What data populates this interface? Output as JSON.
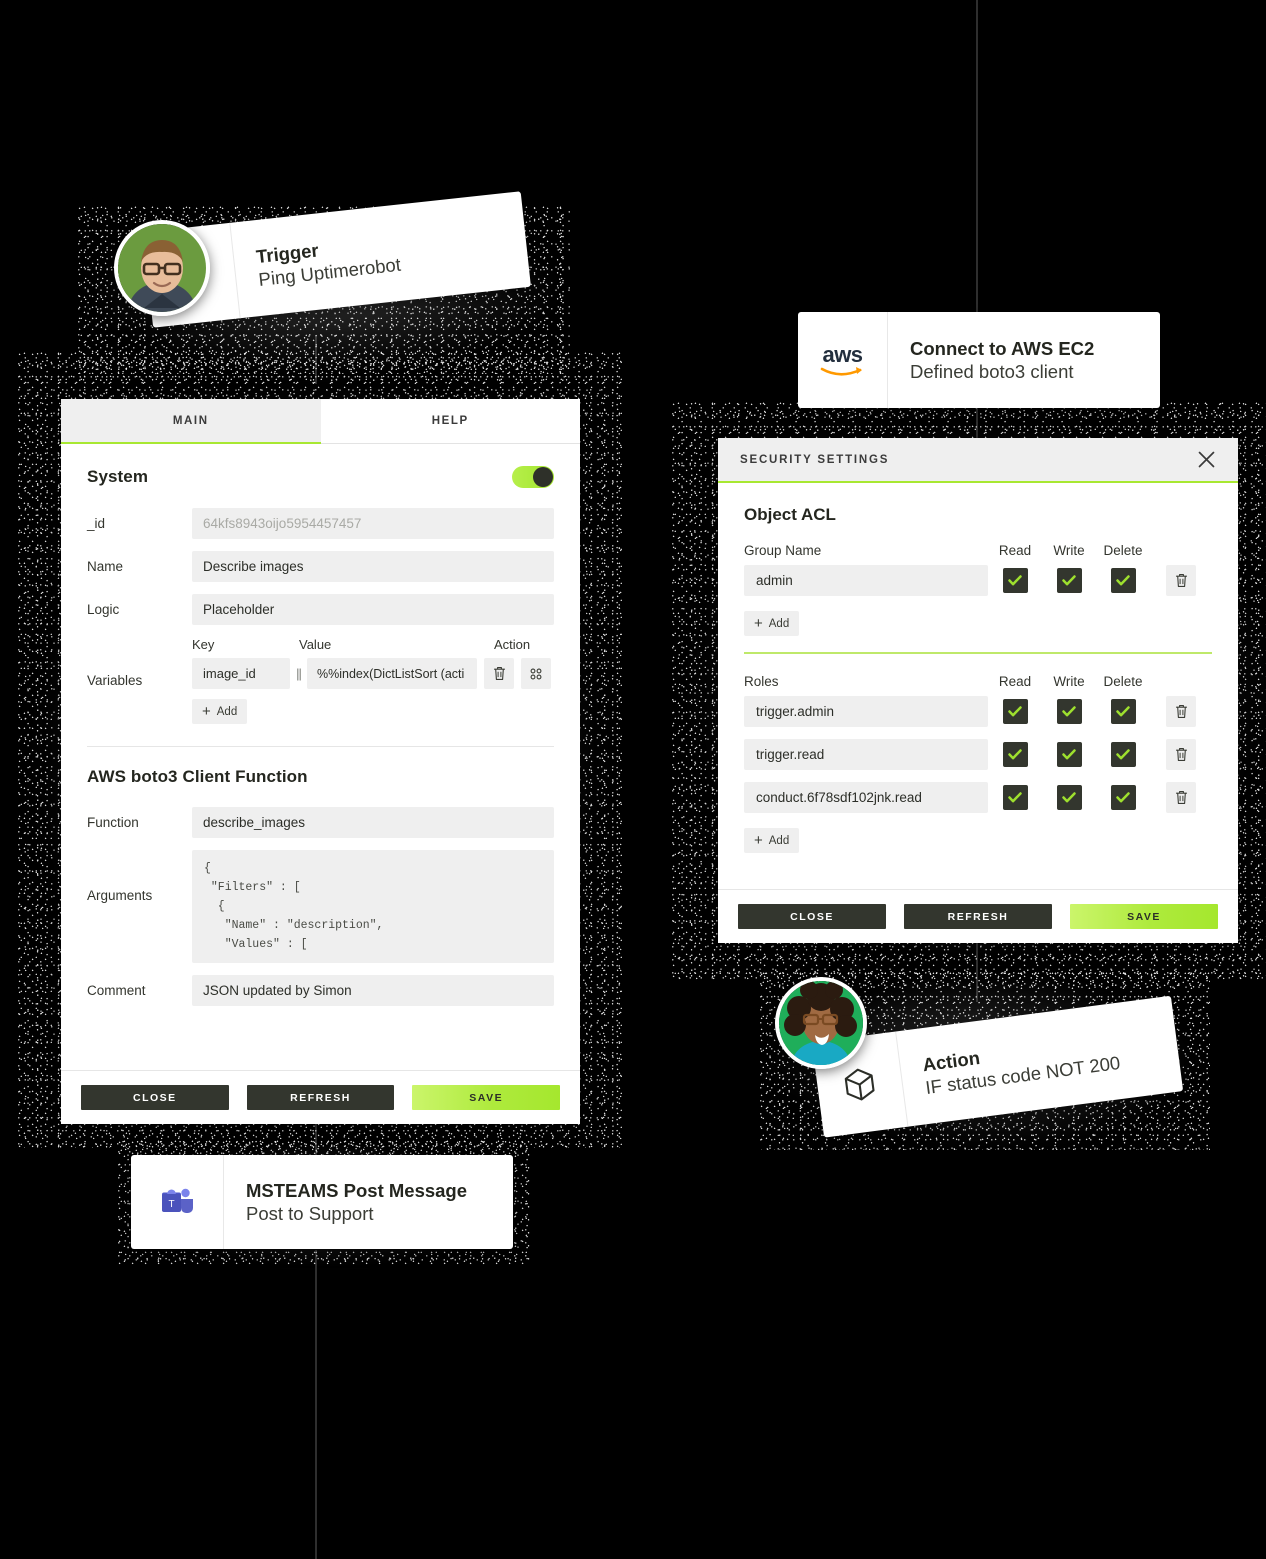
{
  "theme": {
    "accent_green": "#a8e831",
    "dark": "#33362e",
    "field_bg": "#efefef",
    "background": "#000000"
  },
  "nodes": {
    "trigger": {
      "icon": "play-triangle-icon",
      "title": "Trigger",
      "subtitle": "Ping Uptimerobot",
      "avatar": "user-avatar-male"
    },
    "aws": {
      "icon": "aws-logo-icon",
      "logo_text": "aws",
      "title": "Connect to AWS EC2",
      "subtitle": "Defined boto3 client"
    },
    "msteams": {
      "icon": "microsoft-teams-icon",
      "title": "MSTEAMS Post Message",
      "subtitle": "Post to Support"
    },
    "action": {
      "icon": "cube-icon",
      "title": "Action",
      "subtitle": "IF status code NOT 200",
      "avatar": "user-avatar-female"
    }
  },
  "left_panel": {
    "tabs": [
      {
        "label": "MAIN",
        "active": true
      },
      {
        "label": "HELP",
        "active": false
      }
    ],
    "system": {
      "heading": "System",
      "toggle_on": true,
      "fields": [
        {
          "label": "_id",
          "value": "64kfs8943oijo5954457457",
          "muted": true
        },
        {
          "label": "Name",
          "value": "Describe images",
          "muted": false
        },
        {
          "label": "Logic",
          "value": "Placeholder",
          "muted": false
        }
      ],
      "variables": {
        "label": "Variables",
        "headers": {
          "key": "Key",
          "value": "Value",
          "action": "Action"
        },
        "rows": [
          {
            "key": "image_id",
            "separator": "||",
            "value": "%%index(DictListSort (acti",
            "delete_icon": "trash-icon",
            "expand_icon": "grid-icon"
          }
        ],
        "add_label": "Add"
      }
    },
    "boto3": {
      "heading": "AWS boto3 Client Function",
      "function_label": "Function",
      "function_value": "describe_images",
      "arguments_label": "Arguments",
      "arguments_value": "{\n \"Filters\" : [\n  {\n   \"Name\" : \"description\",\n   \"Values\" : [",
      "comment_label": "Comment",
      "comment_value": "JSON updated by Simon"
    },
    "footer": {
      "close": "CLOSE",
      "refresh": "REFRESH",
      "save": "SAVE"
    }
  },
  "security_panel": {
    "header_title": "SECURITY SETTINGS",
    "close_icon": "close-icon",
    "body_title": "Object ACL",
    "groups": {
      "name_header": "Group Name",
      "col_headers": [
        "Read",
        "Write",
        "Delete"
      ],
      "rows": [
        {
          "name": "admin",
          "read": true,
          "write": true,
          "delete": true,
          "delete_icon": "trash-icon"
        }
      ],
      "add_label": "Add"
    },
    "roles": {
      "name_header": "Roles",
      "col_headers": [
        "Read",
        "Write",
        "Delete"
      ],
      "rows": [
        {
          "name": "trigger.admin",
          "read": true,
          "write": true,
          "delete": true,
          "delete_icon": "trash-icon"
        },
        {
          "name": "trigger.read",
          "read": true,
          "write": true,
          "delete": true,
          "delete_icon": "trash-icon"
        },
        {
          "name": "conduct.6f78sdf102jnk.read",
          "read": true,
          "write": true,
          "delete": true,
          "delete_icon": "trash-icon"
        }
      ],
      "add_label": "Add"
    },
    "footer": {
      "close": "CLOSE",
      "refresh": "REFRESH",
      "save": "SAVE"
    }
  }
}
